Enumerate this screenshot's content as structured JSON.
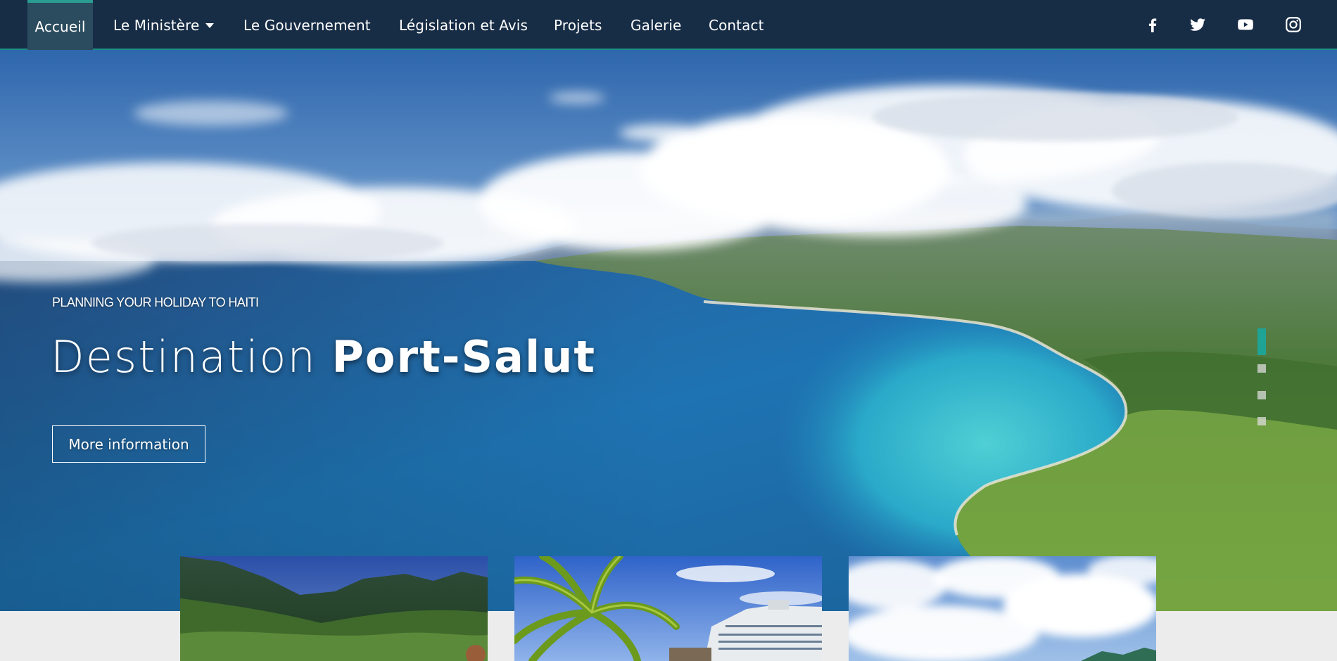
{
  "nav": {
    "items": [
      {
        "label": "Accueil",
        "active": true
      },
      {
        "label": "Le Ministère",
        "dropdown": true
      },
      {
        "label": "Le Gouvernement"
      },
      {
        "label": "Législation et Avis"
      },
      {
        "label": "Projets"
      },
      {
        "label": "Galerie"
      },
      {
        "label": "Contact"
      }
    ],
    "social": [
      "facebook-icon",
      "twitter-icon",
      "youtube-icon",
      "instagram-icon"
    ]
  },
  "hero": {
    "kicker": "PLANNING YOUR HOLIDAY TO HAITI",
    "title_light": "Destination ",
    "title_bold": "Port-Salut",
    "button_label": "More information",
    "slides_total": 4,
    "active_slide": 1
  },
  "cards": [
    {
      "image": "mountain-forest-photo"
    },
    {
      "image": "palm-cruise-ship-photo"
    },
    {
      "image": "cloudy-sky-photo"
    }
  ],
  "colors": {
    "navbar_bg": "#172c45",
    "accent": "#1fa395",
    "page_bg": "#ececec"
  }
}
